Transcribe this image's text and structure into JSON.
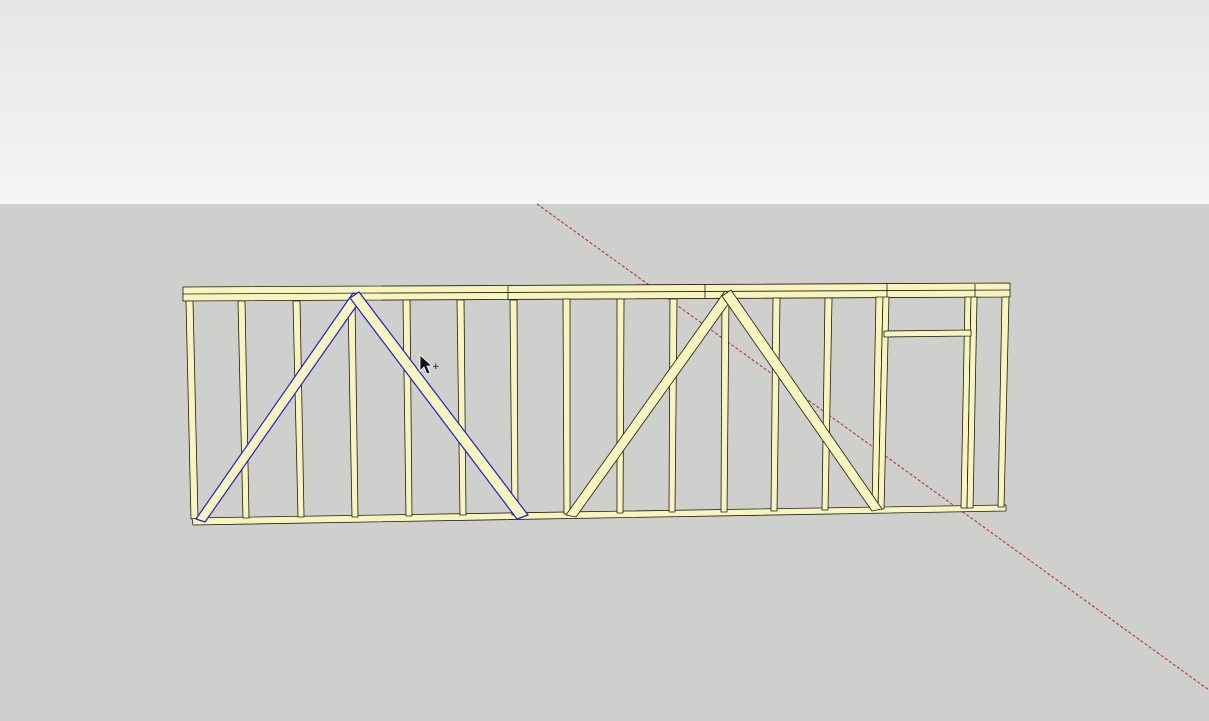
{
  "viewport": {
    "sky_top_color": "#e4e6e8",
    "sky_bottom_color": "#f4f5f6",
    "ground_color": "#cfcfcd"
  },
  "model": {
    "wood_color": "#f8f4bd",
    "edge_color": "#1c1c14",
    "selection_color": "#1e22c8",
    "red_axis_color": "#b52a2a"
  },
  "cursor": {
    "icon": "select-arrow-cursor"
  }
}
